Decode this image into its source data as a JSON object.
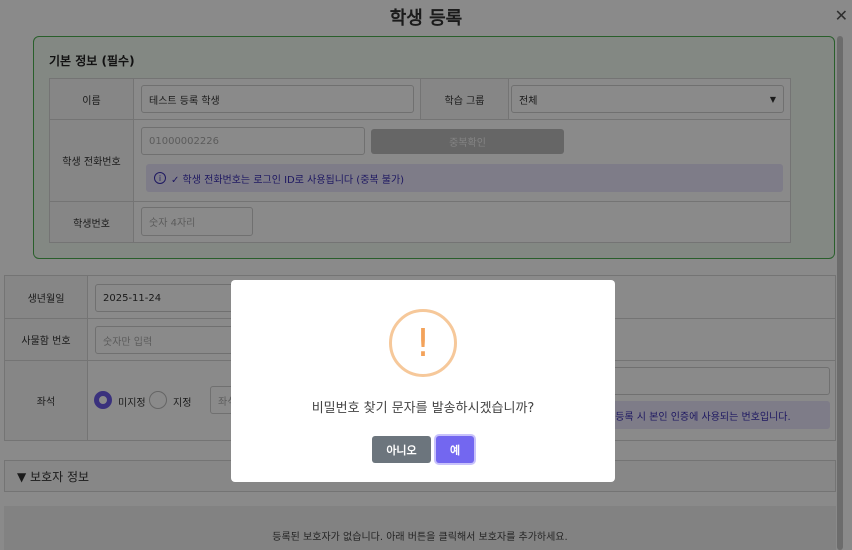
{
  "header": {
    "title": "학생 등록",
    "close_icon": "close-icon"
  },
  "basic": {
    "section_title": "기본 정보 (필수)",
    "name_label": "이름",
    "name_value": "테스트 등록 학생",
    "group_label": "학습 그룹",
    "group_value": "전체",
    "phone_label": "학생 전화번호",
    "phone_placeholder": "01000002226",
    "dup_check": "중복확인",
    "phone_notice": "✓ 학생 전화번호는 로그인 ID로 사용됩니다 (중복 불가)",
    "student_no_label": "학생번호",
    "student_no_placeholder": "숫자 4자리"
  },
  "extra": {
    "birth_label": "생년월일",
    "birth_value": "2025-11-24",
    "seat_no_label": "사물함 번호",
    "seat_no_placeholder": "숫자만 입력",
    "seat_label": "좌석",
    "seat_options": [
      "미지정",
      "지정"
    ],
    "seat_selected": "미지정",
    "seat_input_placeholder": "좌석",
    "right_notice": "재등록 시 본인 인증에 사용되는 번호입니다."
  },
  "guardian": {
    "title": "▼ 보호자 정보",
    "empty_text": "등록된 보호자가 없습니다. 아래 버튼을 클릭해서 보호자를 추가하세요."
  },
  "dialog": {
    "icon": "warning-icon",
    "icon_glyph": "!",
    "message": "비밀번호 찾기 문자를 발송하시겠습니까?",
    "no_label": "아니오",
    "yes_label": "예"
  },
  "colors": {
    "accent": "#7367f0",
    "section_border": "#4caf50",
    "warning": "#f3a25a",
    "secondary_button": "#6c757d"
  }
}
